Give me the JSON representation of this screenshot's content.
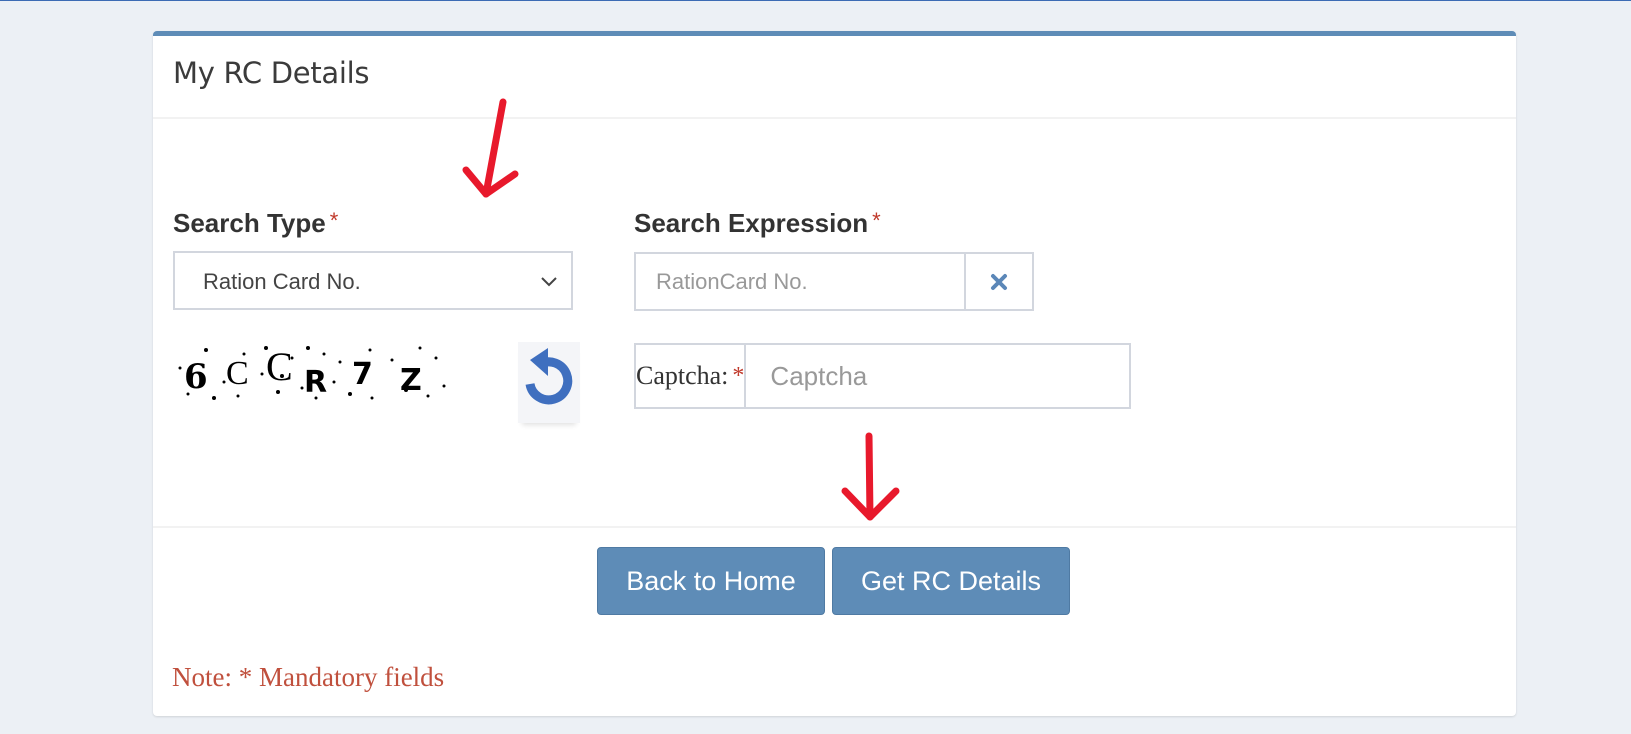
{
  "card": {
    "title": "My RC Details",
    "accent_color": "#5e8cb7"
  },
  "form": {
    "search_type": {
      "label": "Search Type",
      "required_mark": "*",
      "selected": "Ration Card No."
    },
    "search_expression": {
      "label": "Search Expression",
      "required_mark": "*",
      "value": "",
      "placeholder": "RationCard No.",
      "clear_icon": "close-icon"
    },
    "captcha": {
      "image_text": "6CCR7Z",
      "refresh_icon": "refresh-icon",
      "label": "Captcha:",
      "required_mark": "*",
      "value": "",
      "placeholder": "Captcha"
    }
  },
  "buttons": {
    "back_home": "Back to Home",
    "get_details": "Get RC Details"
  },
  "note": "Note: * Mandatory fields",
  "annotations": {
    "arrow_color": "#e8192c",
    "arrows": [
      "points-to-search-type",
      "points-to-get-rc-details"
    ]
  }
}
